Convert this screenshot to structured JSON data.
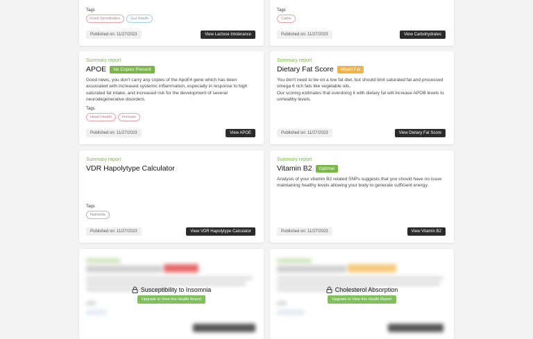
{
  "top_cards": [
    {
      "tags_label": "Tags",
      "tags": [
        {
          "label": "Food Sensitivities",
          "color": "red"
        },
        {
          "label": "Gut Health",
          "color": "blue"
        }
      ],
      "published": "Published on: 11/27/2023",
      "button": "View Lactose Intolerance"
    },
    {
      "tags_label": "Tags",
      "tags": [
        {
          "label": "Carbs",
          "color": "red"
        }
      ],
      "published": "Published on: 11/27/2023",
      "button": "View Carbohydrates"
    }
  ],
  "cards": [
    {
      "summary": "Summary report",
      "title": "APOE",
      "badge": "No Copies Present",
      "badge_color": "#7ab648",
      "description": "Good news, you don't carry any copies of the ApoE4 gene which has been associated with increased systemic inflammation, especially in response to high saturated fat intake, and increased risk for the development of several neurodegenerative disorders.",
      "tags_label": "Tags",
      "tags": [
        {
          "label": "Heart Health",
          "color": "red"
        },
        {
          "label": "Immune",
          "color": "red"
        }
      ],
      "published": "Published on: 11/27/2023",
      "button": "View APOE"
    },
    {
      "summary": "Summary report",
      "title": "Dietary Fat Score",
      "badge": "Mixed Fat",
      "badge_color": "#f0b24a",
      "description": "You don't need to be on a low fat diet, but should limit saturated fat and processed omega 6 rich fats like vegetable oils.\nOur scoring estimates that overdoing it with dietary fat will increase APOB levels to unhealthy levels.",
      "tags_label": "",
      "tags": [],
      "published": "Published on: 11/27/2023",
      "button": "View Dietary Fat Score"
    },
    {
      "summary": "Summary report",
      "title": "VDR Hapolytype Calculator",
      "badge": "",
      "badge_color": "",
      "description": "",
      "tags_label": "Tags",
      "tags": [
        {
          "label": "Nutrients",
          "color": "grey"
        }
      ],
      "published": "Published on: 11/27/2023",
      "button": "View VDR Hapolytype Calculator"
    },
    {
      "summary": "Summary report",
      "title": "Vitamin B2",
      "badge": "Optimal",
      "badge_color": "#7ab648",
      "description": "Analysis of your vitamin B2 related SNPs suggests that you should have no issue maintaining healthy levels allowing your body to generate sufficient energy.",
      "tags_label": "",
      "tags": [],
      "published": "Published on: 11/27/2023",
      "button": "View Vitamin B2"
    }
  ],
  "locked": [
    {
      "title": "Susceptibility to Insomnia",
      "button": "Upgrade to View this Health Report",
      "badge_color": "#e86a6a"
    },
    {
      "title": "Cholesterol Absorption",
      "button": "Upgrade to View this Health Report",
      "badge_color": "#f5c97a"
    }
  ],
  "colors": {
    "accent": "#7ab648",
    "dark_button": "#2b2b2b",
    "upgrade": "#7fbf5c"
  },
  "icons": {
    "lock": "lock-icon"
  }
}
